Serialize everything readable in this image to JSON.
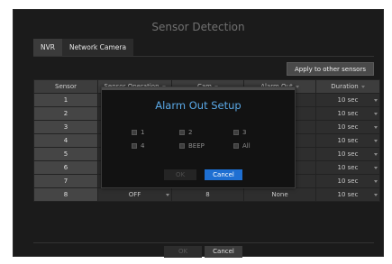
{
  "window": {
    "title": "Sensor Detection"
  },
  "tabs": [
    {
      "label": "NVR"
    },
    {
      "label": "Network Camera"
    }
  ],
  "apply_button": "Apply to other sensors",
  "table": {
    "headers": [
      "Sensor",
      "Sensor Operation",
      "Cam",
      "Alarm Out",
      "Duration"
    ],
    "rows": [
      {
        "sensor": "1",
        "operation": "",
        "cam": "",
        "alarm_out": "",
        "duration": "10 sec"
      },
      {
        "sensor": "2",
        "operation": "",
        "cam": "",
        "alarm_out": "",
        "duration": "10 sec"
      },
      {
        "sensor": "3",
        "operation": "",
        "cam": "",
        "alarm_out": "",
        "duration": "10 sec"
      },
      {
        "sensor": "4",
        "operation": "",
        "cam": "",
        "alarm_out": "",
        "duration": "10 sec"
      },
      {
        "sensor": "5",
        "operation": "",
        "cam": "",
        "alarm_out": "",
        "duration": "10 sec"
      },
      {
        "sensor": "6",
        "operation": "",
        "cam": "",
        "alarm_out": "",
        "duration": "10 sec"
      },
      {
        "sensor": "7",
        "operation": "",
        "cam": "",
        "alarm_out": "",
        "duration": "10 sec"
      },
      {
        "sensor": "8",
        "operation": "OFF",
        "cam": "8",
        "alarm_out": "None",
        "duration": "10 sec"
      }
    ]
  },
  "footer": {
    "ok_label": "OK",
    "cancel_label": "Cancel"
  },
  "modal": {
    "title": "Alarm Out Setup",
    "options": [
      "1",
      "2",
      "3",
      "4",
      "BEEP",
      "All"
    ],
    "ok_label": "OK",
    "cancel_label": "Cancel"
  },
  "colors": {
    "accent": "#1e6fd2",
    "modal_title": "#5aa8e6",
    "window_bg": "#1b1b1b"
  }
}
